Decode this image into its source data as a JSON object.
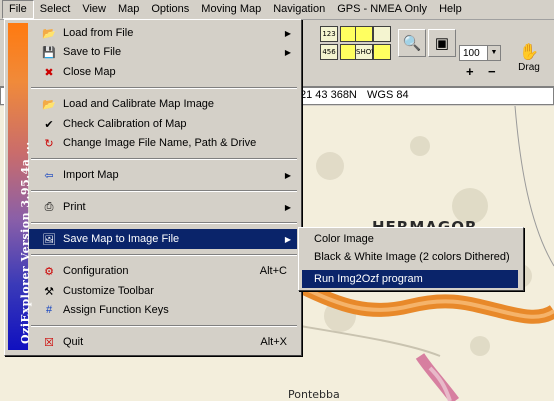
{
  "menubar": {
    "items": [
      "File",
      "Select",
      "View",
      "Map",
      "Options",
      "Moving Map",
      "Navigation",
      "GPS - NMEA Only",
      "Help"
    ]
  },
  "toolbar": {
    "zoom_value": "100",
    "zoom_in_label": "+",
    "zoom_out_label": "−",
    "drag_label": "Drag",
    "icon_labels": [
      "123",
      "456",
      "SHOW"
    ]
  },
  "status": {
    "left_digit": "8",
    "coordinate": "21 43 368N",
    "datum": "WGS 84"
  },
  "map": {
    "town_label": "HERMAGOR",
    "bottom_label": "Pontebba"
  },
  "file_menu": {
    "sidebar_text": "OziExplorer Version 3.95.4a ...",
    "items": [
      {
        "label": "Load from File",
        "icon": "folder-open-icon",
        "submenu": true
      },
      {
        "label": "Save to File",
        "icon": "save-icon",
        "submenu": true
      },
      {
        "label": "Close Map",
        "icon": "close-map-icon"
      },
      {
        "label": "Load and Calibrate Map Image",
        "icon": "folder-open-icon"
      },
      {
        "label": "Check Calibration of Map",
        "icon": "checkmark-icon"
      },
      {
        "label": "Change Image File Name, Path & Drive",
        "icon": "change-file-icon"
      },
      {
        "label": "Import Map",
        "icon": "import-icon",
        "submenu": true
      },
      {
        "label": "Print",
        "icon": "printer-icon",
        "submenu": true
      },
      {
        "label": "Save Map to Image File",
        "icon": "image-save-icon",
        "submenu": true,
        "selected": true
      },
      {
        "label": "Configuration",
        "icon": "configuration-icon",
        "shortcut": "Alt+C"
      },
      {
        "label": "Customize Toolbar",
        "icon": "customize-toolbar-icon"
      },
      {
        "label": "Assign Function Keys",
        "icon": "function-keys-icon"
      },
      {
        "label": "Quit",
        "icon": "quit-icon",
        "shortcut": "Alt+X"
      }
    ]
  },
  "submenu": {
    "items": [
      {
        "label": "Color Image"
      },
      {
        "label": "Black & White Image (2 colors Dithered)"
      },
      {
        "label": "Run Img2Ozf program",
        "selected": true
      }
    ]
  },
  "colors": {
    "menu_face": "#d4d0c8",
    "selection": "#0a246a",
    "map_background": "#f2ecd9",
    "route_orange": "#e8892a"
  }
}
